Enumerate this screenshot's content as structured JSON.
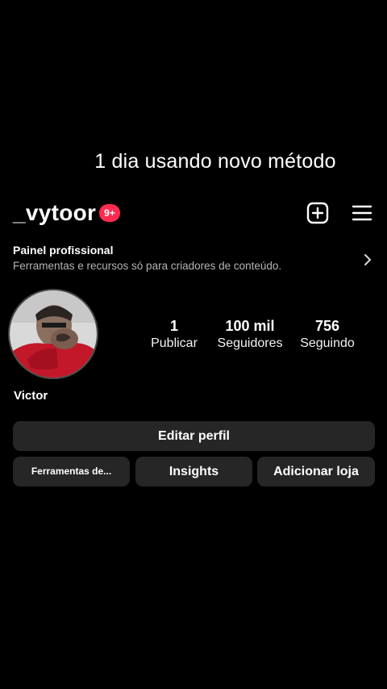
{
  "overlay_caption": "1 dia usando novo método",
  "header": {
    "username": "_vytoor",
    "notification_badge": "9+",
    "icons": [
      "new-post-icon",
      "hamburger-menu-icon"
    ]
  },
  "professional_panel": {
    "title": "Painel profissional",
    "subtitle": "Ferramentas e recursos só para criadores de conteúdo."
  },
  "profile": {
    "display_name": "Victor",
    "stats": [
      {
        "value": "1",
        "label": "Publicar"
      },
      {
        "value": "100 mil",
        "label": "Seguidores"
      },
      {
        "value": "756",
        "label": "Seguindo"
      }
    ]
  },
  "buttons": {
    "edit_profile": "Editar perfil",
    "tools": "Ferramentas de...",
    "insights": "Insights",
    "add_shop": "Adicionar loja"
  },
  "colors": {
    "background": "#000000",
    "badge": "#ff2b51",
    "button_bg": "#262626",
    "subtext": "#b4b4b4"
  }
}
